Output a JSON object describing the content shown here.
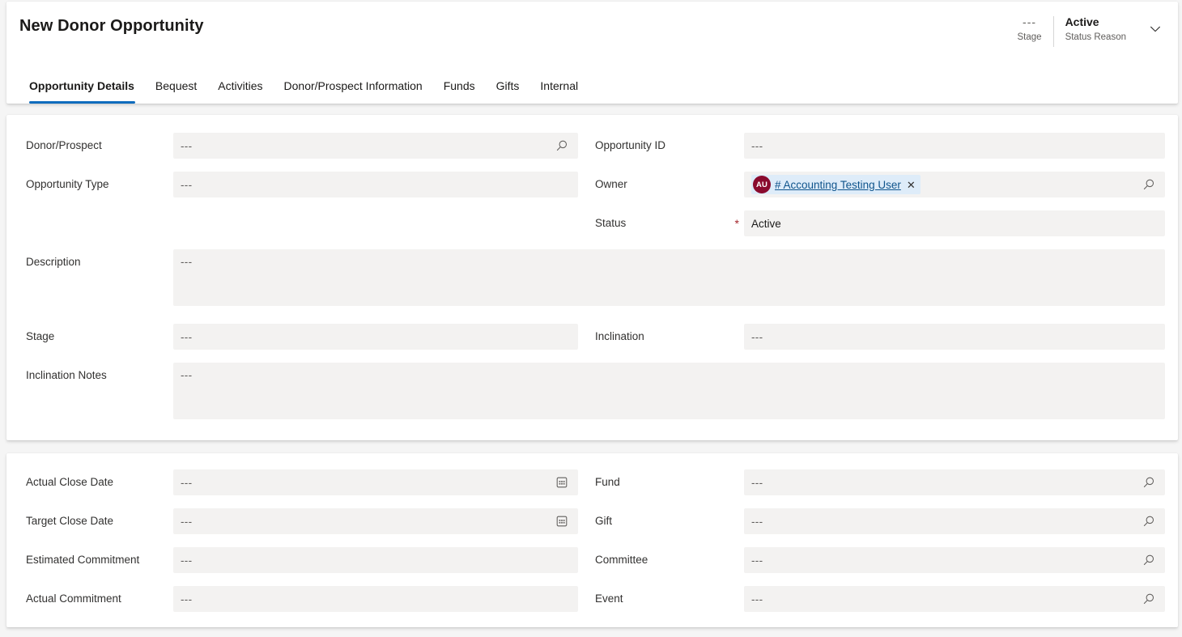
{
  "header": {
    "title": "New Donor Opportunity",
    "stage": {
      "value": "---",
      "label": "Stage"
    },
    "status_reason": {
      "value": "Active",
      "label": "Status Reason"
    },
    "chevron_icon": "chevron-down-icon"
  },
  "tabs": [
    {
      "label": "Opportunity Details",
      "active": true
    },
    {
      "label": "Bequest",
      "active": false
    },
    {
      "label": "Activities",
      "active": false
    },
    {
      "label": "Donor/Prospect Information",
      "active": false
    },
    {
      "label": "Funds",
      "active": false
    },
    {
      "label": "Gifts",
      "active": false
    },
    {
      "label": "Internal",
      "active": false
    }
  ],
  "placeholder": "---",
  "sections": [
    {
      "name": "opportunity-general",
      "left_fields": [
        {
          "label": "Donor/Prospect",
          "value": "---",
          "required": true,
          "locked": false,
          "icon": "search-icon",
          "multiline": false
        },
        {
          "label": "Opportunity Type",
          "value": "---",
          "required": true,
          "locked": false,
          "icon": "",
          "multiline": false
        },
        {
          "label": "Description",
          "value": "---",
          "required": false,
          "locked": false,
          "icon": "",
          "multiline": true
        },
        {
          "label": "Stage",
          "value": "---",
          "required": false,
          "locked": false,
          "icon": "",
          "multiline": false
        },
        {
          "label": "Inclination Notes",
          "value": "---",
          "required": false,
          "locked": false,
          "icon": "",
          "multiline": true
        }
      ],
      "right_fields": [
        {
          "label": "Opportunity ID",
          "value": "---",
          "required": false,
          "locked": false,
          "icon": "",
          "multiline": false
        },
        {
          "label": "Owner",
          "value": "",
          "required": true,
          "locked": false,
          "icon": "search-icon",
          "multiline": false,
          "pill": {
            "initials": "AU",
            "text": "# Accounting Testing User",
            "close_icon": "close-icon",
            "avatar_color": "#8a0b2e"
          }
        },
        {
          "label": "Status",
          "value": "Active",
          "required": true,
          "locked": true,
          "icon": "",
          "multiline": false
        },
        {
          "label": "Inclination",
          "value": "---",
          "required": false,
          "locked": false,
          "icon": "",
          "multiline": false
        }
      ]
    },
    {
      "name": "opportunity-financials",
      "left_fields": [
        {
          "label": "Actual Close Date",
          "value": "---",
          "required": false,
          "locked": false,
          "icon": "calendar-icon",
          "multiline": false
        },
        {
          "label": "Target Close Date",
          "value": "---",
          "required": false,
          "locked": false,
          "icon": "calendar-icon",
          "multiline": false
        },
        {
          "label": "Estimated Commitment",
          "value": "---",
          "required": false,
          "locked": false,
          "icon": "",
          "multiline": false
        },
        {
          "label": "Actual Commitment",
          "value": "---",
          "required": false,
          "locked": false,
          "icon": "",
          "multiline": false
        }
      ],
      "right_fields": [
        {
          "label": "Fund",
          "value": "---",
          "required": false,
          "locked": false,
          "icon": "search-icon",
          "multiline": false
        },
        {
          "label": "Gift",
          "value": "---",
          "required": false,
          "locked": false,
          "icon": "search-icon",
          "multiline": false
        },
        {
          "label": "Committee",
          "value": "---",
          "required": false,
          "locked": false,
          "icon": "search-icon",
          "multiline": false
        },
        {
          "label": "Event",
          "value": "---",
          "required": false,
          "locked": false,
          "icon": "search-icon",
          "multiline": false
        }
      ]
    }
  ],
  "colors": {
    "accent": "#0f6cbd",
    "required": "#a4262c",
    "field_bg": "#f3f2f1",
    "page_bg": "#f5f5f5",
    "link": "#0f548c",
    "pill_bg": "#deecf9"
  }
}
